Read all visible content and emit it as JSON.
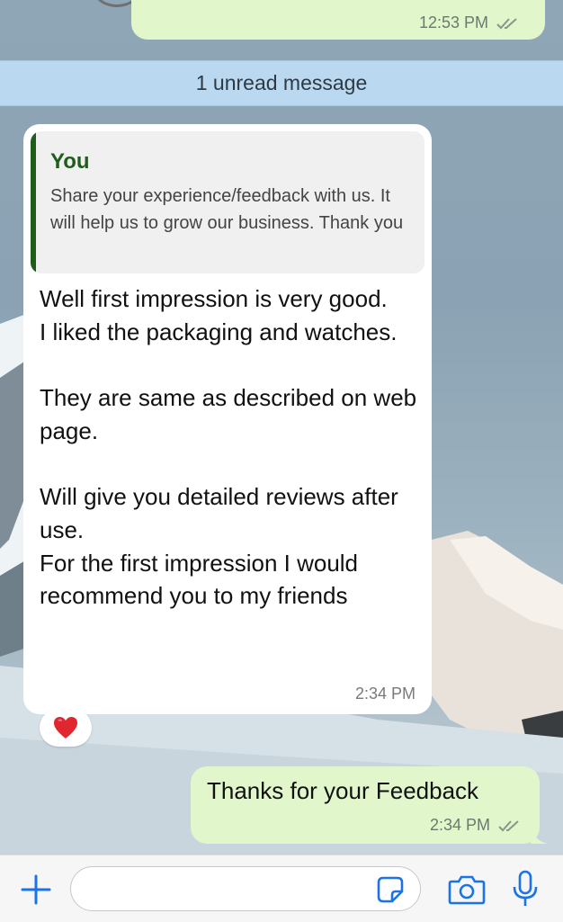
{
  "chat": {
    "previous_message": {
      "time": "12:53 PM"
    },
    "unread_banner": "1 unread message",
    "incoming": {
      "quote_author": "You",
      "quote_text": "Share your experience/feedback with us. It will help us to grow our business. Thank you",
      "text": "Well first impression is very good.\nI liked the packaging and watches.\n\nThey are same as described on web page.\n\nWill give you detailed reviews after use.\nFor the first impression I would recommend you to my friends",
      "time": "2:34 PM",
      "reaction": "❤️"
    },
    "outgoing": {
      "text": "Thanks for your Feedback",
      "time": "2:34 PM"
    }
  },
  "input_bar": {
    "message_placeholder": "",
    "icons": [
      "plus-icon",
      "sticker-icon",
      "camera-icon",
      "microphone-icon"
    ]
  },
  "colors": {
    "outgoing_bubble": "#e1f6cb",
    "incoming_bubble": "#ffffff",
    "quote_accent": "#1e5e1a",
    "unread_banner": "#bedcf5",
    "action_blue": "#1a73e8"
  }
}
